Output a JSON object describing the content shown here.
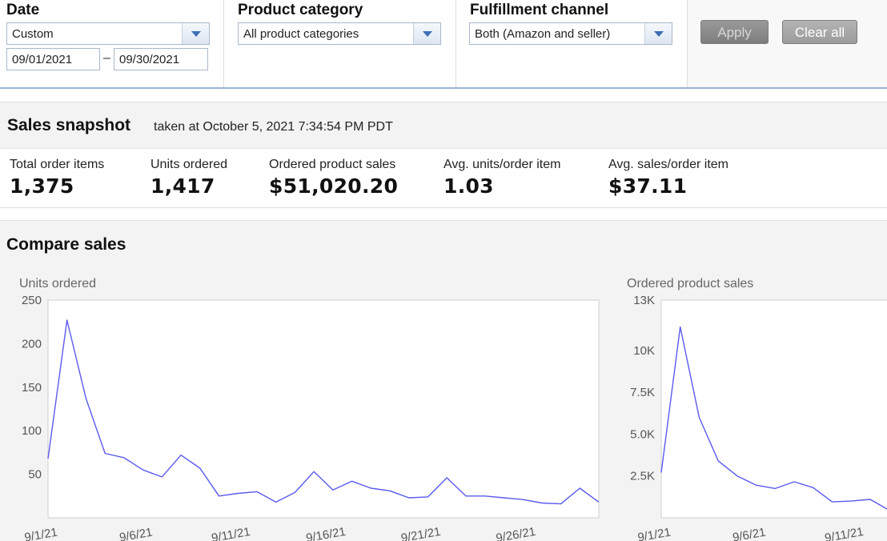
{
  "filters": {
    "date": {
      "label": "Date",
      "selected": "Custom",
      "start": "09/01/2021",
      "end": "09/30/2021",
      "separator": "–"
    },
    "category": {
      "label": "Product category",
      "selected": "All product categories"
    },
    "fulfillment": {
      "label": "Fulfillment channel",
      "selected": "Both (Amazon and seller)"
    },
    "apply_label": "Apply",
    "clear_label": "Clear all"
  },
  "snapshot": {
    "title": "Sales snapshot",
    "subtitle": "taken at October 5, 2021 7:34:54 PM PDT",
    "metrics": [
      {
        "label": "Total order items",
        "value": "1,375"
      },
      {
        "label": "Units ordered",
        "value": "1,417"
      },
      {
        "label": "Ordered product sales",
        "value": "$51,020.20"
      },
      {
        "label": "Avg. units/order item",
        "value": "1.03"
      },
      {
        "label": "Avg. sales/order item",
        "value": "$37.11"
      }
    ]
  },
  "compare": {
    "title": "Compare sales"
  },
  "chart_data": [
    {
      "type": "line",
      "title": "Units ordered",
      "xlabel": "",
      "ylabel": "",
      "x": [
        "9/1/21",
        "9/2/21",
        "9/3/21",
        "9/4/21",
        "9/5/21",
        "9/6/21",
        "9/7/21",
        "9/8/21",
        "9/9/21",
        "9/10/21",
        "9/11/21",
        "9/12/21",
        "9/13/21",
        "9/14/21",
        "9/15/21",
        "9/16/21",
        "9/17/21",
        "9/18/21",
        "9/19/21",
        "9/20/21",
        "9/21/21",
        "9/22/21",
        "9/23/21",
        "9/24/21",
        "9/25/21",
        "9/26/21",
        "9/27/21",
        "9/28/21",
        "9/29/21",
        "9/30/21"
      ],
      "series": [
        {
          "values": [
            68,
            227,
            137,
            74,
            69,
            55,
            47,
            72,
            57,
            25,
            28,
            30,
            18,
            29,
            53,
            32,
            42,
            34,
            31,
            23,
            24,
            46,
            25,
            25,
            23,
            21,
            17,
            16,
            34,
            18
          ]
        }
      ],
      "ylim": [
        0,
        250
      ],
      "yticks": [
        "50",
        "100",
        "150",
        "200",
        "250"
      ],
      "xticks": [
        "9/1/21",
        "9/6/21",
        "9/11/21",
        "9/16/21",
        "9/21/21",
        "9/26/21"
      ],
      "line_color": "#5a5aef",
      "grid": false
    },
    {
      "type": "line",
      "title": "Ordered product sales",
      "xlabel": "",
      "ylabel": "",
      "x": [
        "9/1/21",
        "9/2/21",
        "9/3/21",
        "9/4/21",
        "9/5/21",
        "9/6/21",
        "9/7/21",
        "9/8/21",
        "9/9/21",
        "9/10/21",
        "9/11/21",
        "9/12/21",
        "9/13/21",
        "9/14/21"
      ],
      "series": [
        {
          "values": [
            2700,
            11400,
            6000,
            3400,
            2500,
            1950,
            1750,
            2150,
            1800,
            950,
            1000,
            1100,
            450,
            400
          ]
        }
      ],
      "ylim": [
        0,
        13000
      ],
      "yticks": [
        "2.5K",
        "5.0K",
        "7.5K",
        "10K",
        "13K"
      ],
      "xticks": [
        "9/1/21",
        "9/6/21",
        "9/11/21"
      ],
      "line_color": "#5a5aef",
      "grid": false
    }
  ]
}
